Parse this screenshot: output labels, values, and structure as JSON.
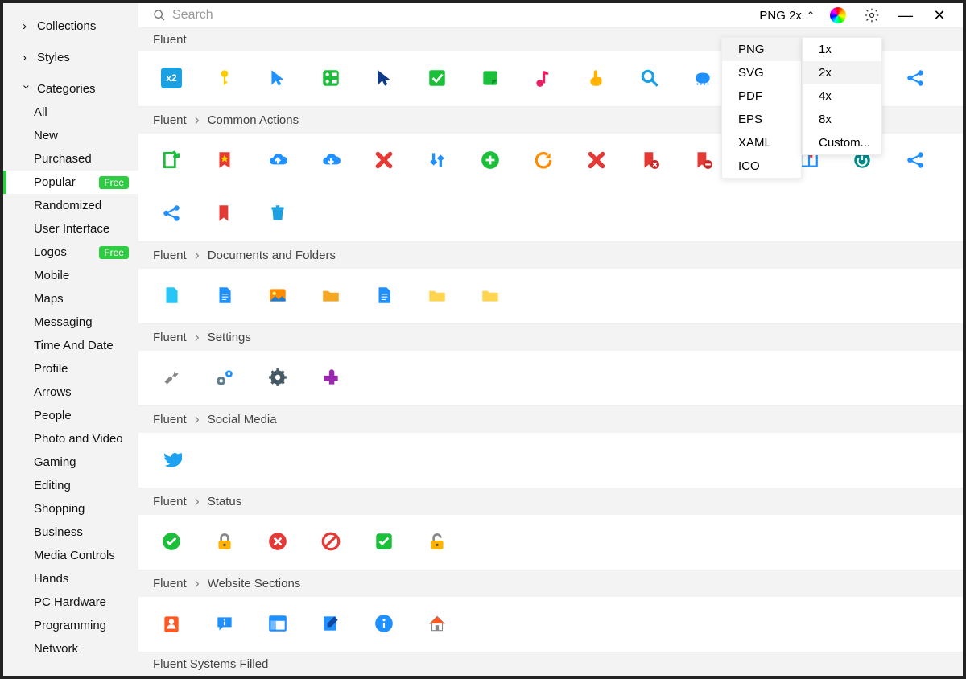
{
  "topbar": {
    "search_placeholder": "Search",
    "format_label": "PNG 2x"
  },
  "sidebar": {
    "collections_label": "Collections",
    "styles_label": "Styles",
    "categories_label": "Categories",
    "free_badge": "Free",
    "categories": [
      "All",
      "New",
      "Purchased",
      "Popular",
      "Randomized",
      "User Interface",
      "Logos",
      "Mobile",
      "Maps",
      "Messaging",
      "Time And Date",
      "Profile",
      "Arrows",
      "People",
      "Photo and Video",
      "Gaming",
      "Editing",
      "Shopping",
      "Business",
      "Media Controls",
      "Hands",
      "PC Hardware",
      "Programming",
      "Network"
    ]
  },
  "format_dropdown": {
    "formats": [
      "PNG",
      "SVG",
      "PDF",
      "EPS",
      "XAML",
      "ICO"
    ],
    "selected_format": "PNG",
    "sizes": [
      "1x",
      "2x",
      "4x",
      "8x",
      "Custom..."
    ],
    "selected_size": "2x"
  },
  "sections": [
    {
      "breadcrumb": [
        "Fluent"
      ],
      "icons": [
        {
          "name": "x2-badge-icon",
          "color": "#1ba1e2",
          "label": "x2"
        },
        {
          "name": "key-icon",
          "color": "#ffcc00"
        },
        {
          "name": "cursor-blue-icon",
          "color": "#1e90ff"
        },
        {
          "name": "board-icon",
          "color": "#1bbf3a"
        },
        {
          "name": "cursor-dark-icon",
          "color": "#0f3a8a"
        },
        {
          "name": "checkbox-select-icon",
          "color": "#1bbf3a"
        },
        {
          "name": "note-icon",
          "color": "#1bbf3a"
        },
        {
          "name": "music-note-icon",
          "color": "#e91e63"
        },
        {
          "name": "hand-point-icon",
          "color": "#ffb300"
        },
        {
          "name": "magnify-icon",
          "color": "#1ba1e2"
        },
        {
          "name": "stamp-icon",
          "color": "#1e90ff"
        },
        {
          "name": "color-icon",
          "color": "#e91e63"
        },
        {
          "name": "language-icon",
          "color": "#1e90ff"
        },
        {
          "name": "refresh-icon",
          "color": "#008b8b"
        },
        {
          "name": "share-alt-icon",
          "color": "#1e90ff"
        }
      ]
    },
    {
      "breadcrumb": [
        "Fluent",
        "Common Actions"
      ],
      "icons": [
        {
          "name": "export-icon",
          "color": "#1bbf3a"
        },
        {
          "name": "bookmark-star-icon",
          "color": "#e53935"
        },
        {
          "name": "cloud-upload-icon",
          "color": "#1e90ff"
        },
        {
          "name": "cloud-download-icon",
          "color": "#1e90ff"
        },
        {
          "name": "x-close-icon",
          "color": "#e53935"
        },
        {
          "name": "swap-icon",
          "color": "#1e90ff"
        },
        {
          "name": "add-circle-icon",
          "color": "#1bbf3a"
        },
        {
          "name": "rotate-icon",
          "color": "#ff8c00"
        },
        {
          "name": "x-cursor-icon",
          "color": "#e53935"
        },
        {
          "name": "bookmark-x-icon",
          "color": "#e53935"
        },
        {
          "name": "bookmark-minus-icon",
          "color": "#e53935"
        },
        {
          "name": "bookmark-query-icon",
          "color": "#e53935"
        },
        {
          "name": "book-open-icon",
          "color": "#1e90ff"
        },
        {
          "name": "power-restart-icon",
          "color": "#008b8b"
        },
        {
          "name": "share-net-icon",
          "color": "#1e90ff"
        },
        {
          "name": "share-icon",
          "color": "#1e90ff"
        },
        {
          "name": "bookmark-icon",
          "color": "#e53935"
        },
        {
          "name": "trash-icon",
          "color": "#1ba1e2"
        }
      ]
    },
    {
      "breadcrumb": [
        "Fluent",
        "Documents and Folders"
      ],
      "icons": [
        {
          "name": "file-blank-icon",
          "color": "#29c5f6"
        },
        {
          "name": "file-text-icon",
          "color": "#1e90ff"
        },
        {
          "name": "image-icon",
          "color": "#ff8c00"
        },
        {
          "name": "folder-open-icon",
          "color": "#f5a623"
        },
        {
          "name": "document-lines-icon",
          "color": "#1e90ff"
        },
        {
          "name": "folder-icon",
          "color": "#ffd54f"
        },
        {
          "name": "folder-alt-icon",
          "color": "#ffd54f"
        }
      ]
    },
    {
      "breadcrumb": [
        "Fluent",
        "Settings"
      ],
      "icons": [
        {
          "name": "wrench-icon",
          "color": "#888"
        },
        {
          "name": "gears-icon",
          "color": "#607d8b"
        },
        {
          "name": "gear-icon",
          "color": "#455a64"
        },
        {
          "name": "plugin-icon",
          "color": "#9c27b0"
        }
      ]
    },
    {
      "breadcrumb": [
        "Fluent",
        "Social Media"
      ],
      "icons": [
        {
          "name": "twitter-icon",
          "color": "#1da1f2"
        }
      ]
    },
    {
      "breadcrumb": [
        "Fluent",
        "Status"
      ],
      "icons": [
        {
          "name": "check-circle-icon",
          "color": "#1bbf3a"
        },
        {
          "name": "lock-icon",
          "color": "#ffb300"
        },
        {
          "name": "error-circle-icon",
          "color": "#e53935"
        },
        {
          "name": "block-icon",
          "color": "#e53935"
        },
        {
          "name": "check-square-icon",
          "color": "#1bbf3a"
        },
        {
          "name": "unlock-icon",
          "color": "#ffb300"
        }
      ]
    },
    {
      "breadcrumb": [
        "Fluent",
        "Website Sections"
      ],
      "icons": [
        {
          "name": "contact-card-icon",
          "color": "#ff5722"
        },
        {
          "name": "chat-info-icon",
          "color": "#1e90ff"
        },
        {
          "name": "layout-icon",
          "color": "#1e90ff"
        },
        {
          "name": "edit-note-icon",
          "color": "#1e90ff"
        },
        {
          "name": "info-circle-icon",
          "color": "#1e90ff"
        },
        {
          "name": "home-icon",
          "color": "#ff5722"
        }
      ]
    },
    {
      "breadcrumb": [
        "Fluent Systems Filled"
      ],
      "icons": []
    }
  ]
}
